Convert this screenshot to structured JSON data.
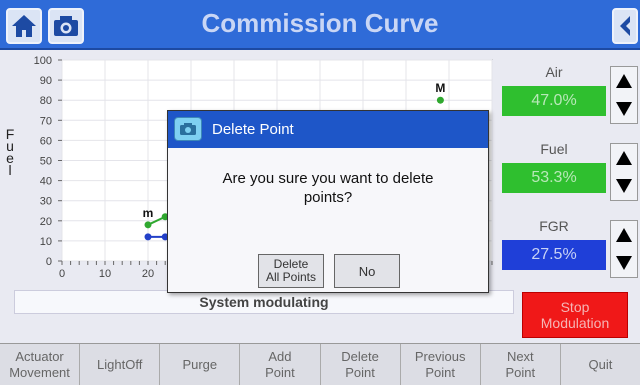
{
  "header": {
    "title": "Commission Curve",
    "icons": [
      "home-icon",
      "camera-icon",
      "back-icon"
    ],
    "color": "#2f6bd8"
  },
  "chart_data": {
    "type": "line",
    "ylabel": "Fuel",
    "xlim": [
      0,
      100
    ],
    "ylim": [
      0,
      100
    ],
    "x_ticks": [
      "0",
      "10",
      "20"
    ],
    "y_ticks": [
      "0",
      "10",
      "20",
      "30",
      "40",
      "50",
      "60",
      "70",
      "80",
      "90",
      "100"
    ],
    "grid": true,
    "series": [
      {
        "color": "#2fa82f",
        "marker_label": "m",
        "points": [
          [
            20,
            18
          ],
          [
            24,
            22
          ]
        ]
      },
      {
        "color": "#2340c8",
        "points": [
          [
            20,
            12
          ],
          [
            24,
            12
          ]
        ]
      },
      {
        "color": "#2fa82f",
        "marker_label": "M",
        "points": [
          [
            88,
            80
          ]
        ]
      }
    ]
  },
  "controls": {
    "air": {
      "label": "Air",
      "value": "47.0%"
    },
    "fuel": {
      "label": "Fuel",
      "value": "53.3%"
    },
    "fgr": {
      "label": "FGR",
      "value": "27.5%"
    }
  },
  "status": {
    "text": "System modulating"
  },
  "stop_button": {
    "line1": "Stop",
    "line2": "Modulation"
  },
  "toolbar": [
    {
      "line1": "Actuator",
      "line2": "Movement"
    },
    {
      "line1": "LightOff",
      "line2": ""
    },
    {
      "line1": "Purge",
      "line2": ""
    },
    {
      "line1": "Add",
      "line2": "Point"
    },
    {
      "line1": "Delete",
      "line2": "Point"
    },
    {
      "line1": "Previous",
      "line2": "Point"
    },
    {
      "line1": "Next",
      "line2": "Point"
    },
    {
      "line1": "Quit",
      "line2": ""
    }
  ],
  "dialog": {
    "title": "Delete Point",
    "message_line1": "Are you sure you want to delete",
    "message_line2": "points?",
    "delete_line1": "Delete",
    "delete_line2": "All Points",
    "no_label": "No"
  }
}
